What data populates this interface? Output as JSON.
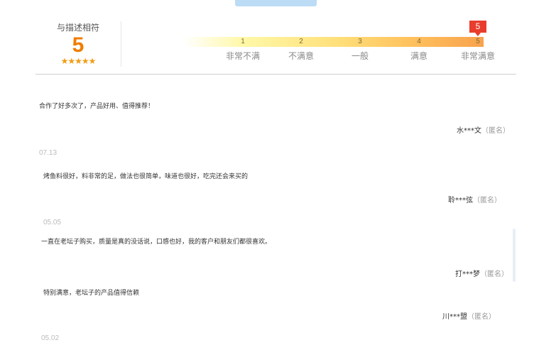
{
  "rating": {
    "title": "与描述相符",
    "score": "5",
    "stars": "★★★★★"
  },
  "scale": {
    "selected": 5,
    "badge": "5",
    "ticks": [
      {
        "num": "1",
        "label": "非常不满"
      },
      {
        "num": "2",
        "label": "不满意"
      },
      {
        "num": "3",
        "label": "一般"
      },
      {
        "num": "4",
        "label": "满意"
      },
      {
        "num": "5",
        "label": "非常满意"
      }
    ]
  },
  "reviews": [
    {
      "text": "合作了好多次了，产品好用、值得推荐！",
      "user": "水***文",
      "anon": "（匿名）",
      "date": "07.13"
    },
    {
      "text": "烤鱼料很好，料非常的足，做法也很简单，味道也很好，吃完还会来买的",
      "user": "聆***弦",
      "anon": "（匿名）",
      "date": "05.05"
    },
    {
      "text": "一直在老坛子购买，质量是真的没话说，口感也好，我的客户和朋友们都很喜欢。",
      "user": "打***梦",
      "anon": "（匿名）",
      "date": ""
    },
    {
      "text": "特别满意，老坛子的产品值得信赖",
      "user": "川***盟",
      "anon": "（匿名）",
      "date": "05.02"
    }
  ],
  "colors": {
    "score": "#f07d00",
    "stars": "#f29c12",
    "badge": "#e83d2c",
    "bar_end": "#f8a24d"
  }
}
